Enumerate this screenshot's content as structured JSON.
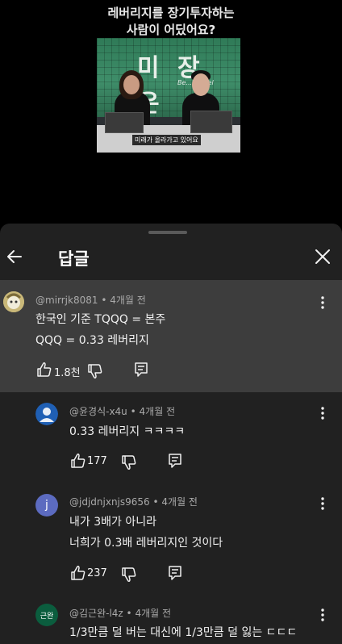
{
  "video": {
    "caption_lines": [
      "레버리지를 장기투자하는",
      "사람이 어딨어요?"
    ],
    "frame_logo": "미 장 은",
    "frame_sub": "Be...ful Fiel",
    "frame_subtitle": "미래가 올라가고 있어요"
  },
  "sheet": {
    "title": "답글"
  },
  "parent_comment": {
    "author": "@mirrjk8081",
    "time": "4개월 전",
    "lines": [
      "한국인 기준 TQQQ = 본주",
      "QQQ = 0.33 레버리지"
    ],
    "likes": "1.8천"
  },
  "replies": [
    {
      "author": "@윤경식-x4u",
      "time": "4개월 전",
      "avatar_color": "#1f5fb4",
      "avatar_text": "",
      "lines": [
        "0.33 레버리지 ㅋㅋㅋㅋ"
      ],
      "likes": "177"
    },
    {
      "author": "@jdjdnjxnjs9656",
      "time": "4개월 전",
      "avatar_color": "#5c6bc0",
      "avatar_text": "j",
      "lines": [
        "내가 3배가 아니라",
        "너희가 0.3배 레버리지인 것이다"
      ],
      "likes": "237"
    },
    {
      "author": "@김근완-l4z",
      "time": "4개월 전",
      "avatar_color": "#0b5d3e",
      "avatar_text": "근완",
      "lines": [
        "1/3만큼 덜 버는 대신에 1/3만큼 덜 잃는 ㄷㄷㄷ"
      ],
      "likes": ""
    }
  ],
  "icons": {
    "back": "arrow-left-icon",
    "close": "close-icon",
    "more": "more-vert-icon",
    "like": "thumb-up-icon",
    "dislike": "thumb-down-icon",
    "reply": "comment-icon"
  },
  "colors": {
    "sheet_bg": "#212121",
    "highlight_bg": "#3d3d3d",
    "meta_text": "#aaaaaa"
  }
}
